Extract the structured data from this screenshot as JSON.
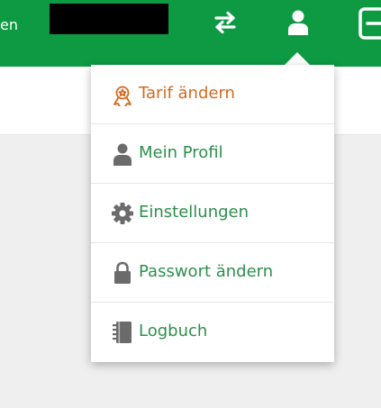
{
  "header": {
    "left_text_fragment": "en"
  },
  "menu": {
    "items": [
      {
        "label": "Tarif ändern",
        "icon": "tariff-badge-icon"
      },
      {
        "label": "Mein Profil",
        "icon": "user-icon"
      },
      {
        "label": "Einstellungen",
        "icon": "gear-icon"
      },
      {
        "label": "Passwort ändern",
        "icon": "lock-icon"
      },
      {
        "label": "Logbuch",
        "icon": "notebook-icon"
      }
    ]
  },
  "colors": {
    "header_green": "#0d9a43",
    "menu_text_green": "#2d8f4b",
    "tariff_orange": "#d46a1f",
    "icon_gray": "#6b6b6b"
  }
}
